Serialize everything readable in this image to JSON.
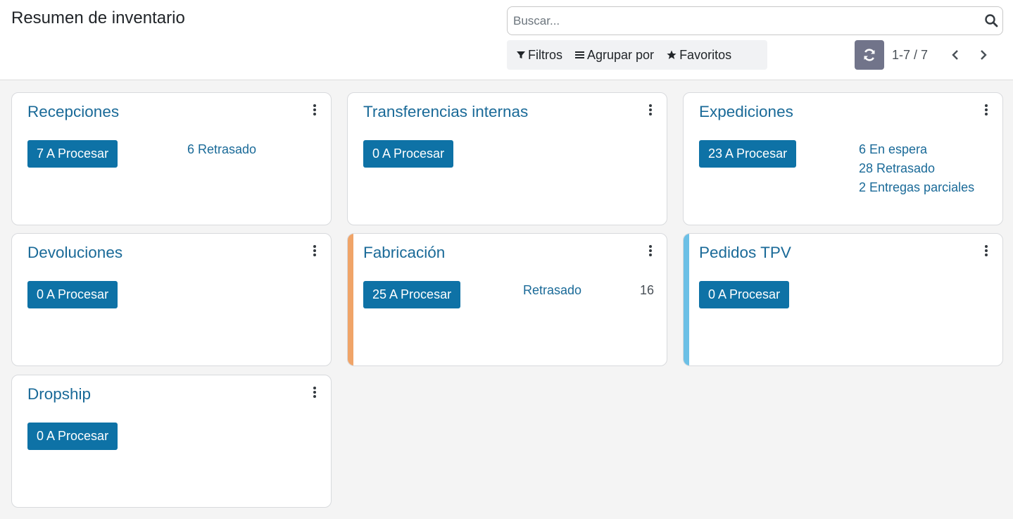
{
  "header": {
    "title": "Resumen de inventario",
    "search_placeholder": "Buscar...",
    "filters_label": "Filtros",
    "group_by_label": "Agrupar por",
    "favorites_label": "Favoritos",
    "pager_value": "1-7 / 7"
  },
  "colors": {
    "primary": "#0e72a6",
    "link": "#1a6a98",
    "fabricacion_accent": "#f0a468",
    "pedidos_tpv_accent": "#6cc0e6"
  },
  "cards": [
    {
      "title": "Recepciones",
      "button": "7 A Procesar",
      "stats": [
        "6 Retrasado"
      ]
    },
    {
      "title": "Transferencias internas",
      "button": "0 A Procesar",
      "stats": []
    },
    {
      "title": "Expediciones",
      "button": "23 A Procesar",
      "stats": [
        "6 En espera",
        "28 Retrasado",
        "2 Entregas parciales"
      ]
    },
    {
      "title": "Devoluciones",
      "button": "0 A Procesar",
      "stats": []
    },
    {
      "title": "Fabricación",
      "button": "25 A Procesar",
      "stats": [
        "Retrasado"
      ],
      "count": "16"
    },
    {
      "title": "Pedidos TPV",
      "button": "0 A Procesar",
      "stats": []
    },
    {
      "title": "Dropship",
      "button": "0 A Procesar",
      "stats": []
    }
  ]
}
